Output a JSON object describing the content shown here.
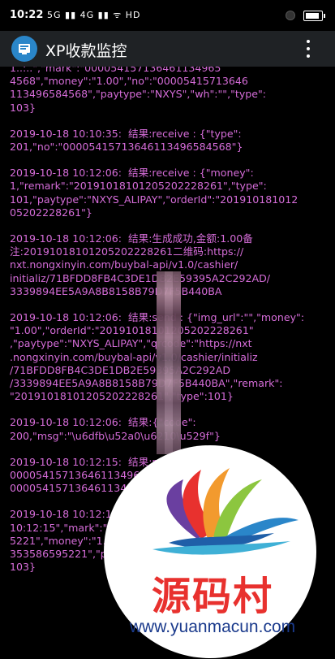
{
  "status_bar": {
    "time": "10:22",
    "network": "5G ▮▮ 4G ▮▮ ᯤ HD"
  },
  "app_bar": {
    "title": "XP收款监控",
    "icon": "monitor-app-icon",
    "menu_icon": "overflow-menu-icon"
  },
  "log": {
    "color": "#d56cd8",
    "entries": [
      {
        "lines": [
          "1..:..\",\"mark\":\"000054157136461134965",
          "4568\",\"money\":\"1.00\",\"no\":\"00005415713646",
          "113496584568\",\"paytype\":\"NXYS\",\"wh\":\"\",\"type\":",
          "103}"
        ]
      },
      {
        "lines": [
          "2019-10-18 10:10:35:  结果:receive : {\"type\":",
          "201,\"no\":\"00005415713646113496584568\"}"
        ]
      },
      {
        "lines": [
          "2019-10-18 10:12:06:  结果:receive : {\"money\":",
          "1,\"remark\":\"20191018101205202228261\",\"type\":",
          "101,\"paytype\":\"NXYS_ALIPAY\",\"orderId\":\"201910181012",
          "05202228261\"}"
        ]
      },
      {
        "lines": [
          "2019-10-18 10:12:06:  结果:生成成功,金额:1.00备",
          "注:20191018101205202228261二维码:https://",
          "nxt.nongxinyin.com/buybal-api/v1.0/cashier/",
          "initializ/71BFDD8FB4C3DE1DB2E59395A2C292AD/",
          "3339894EE5A9A8B8158B79D7F5B440BA"
        ]
      },
      {
        "lines": [
          "2019-10-18 10:12:06:  结果:send : {\"img_url\":\"\",\"money\":",
          "\"1.00\",\"orderId\":\"20191018101205202228261\"",
          ",\"paytype\":\"NXYS_ALIPAY\",\"qrcode\":\"https://nxt",
          ".nongxinyin.com/buybal-api/v1.0/cashier/initializ",
          "/71BFDD8FB4C3DE1DB2E59395A2C292AD",
          "/3339894EE5A9A8B8158B79D7F5B440BA\",\"remark\":",
          "\"20191018101205202228261\",\"type\":101}"
        ]
      },
      {
        "lines": [
          "2019-10-18 10:12:06:  结果:{\"code\":",
          "200,\"msg\":\"\\u6dfb\\u52a0\\u6210\\u529f\"}"
        ]
      },
      {
        "lines": [
          "2019-10-18 10:12:15:  结果:receive : {\"no\":\"",
          "000054157136461134965",
          "00005415713646113496"
        ]
      },
      {
        "lines": [
          "2019-10-18 10:12:15:  结果:receive : {\"time\":",
          "10:12:15\",\"mark\":\"0000541571364611353586595",
          "5221\",\"money\":\"1.00\",\"no\":\"000054157136461",
          "353586595221\",\"paytype\":\"NXYS\",\"wh\":\"\",\"type\":",
          "103}"
        ]
      }
    ]
  },
  "watermark": {
    "text": "源码村",
    "url": "www.yuanmacun.com"
  }
}
